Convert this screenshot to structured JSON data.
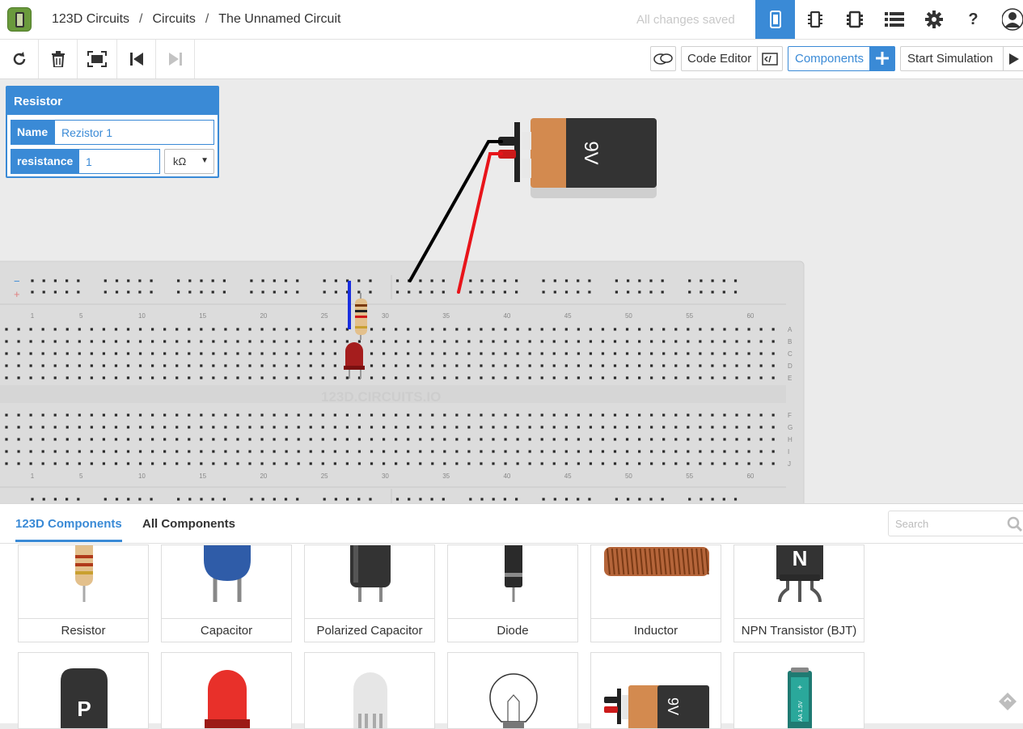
{
  "header": {
    "breadcrumb": [
      "123D Circuits",
      "Circuits",
      "The Unnamed Circuit"
    ],
    "breadcrumb_sep": "/",
    "status": "All changes saved",
    "icons": [
      "breadboard-view-icon",
      "schematic-view-icon",
      "pcb-view-icon",
      "list-icon",
      "gear-icon",
      "help-icon",
      "avatar-icon"
    ],
    "help_label": "?"
  },
  "toolbar": {
    "tools": [
      "rotate-icon",
      "trash-icon",
      "fit-view-icon",
      "step-back-icon",
      "step-forward-icon"
    ],
    "code_editor_label": "Code Editor",
    "components_label": "Components",
    "start_simulation_label": "Start Simulation"
  },
  "inspector": {
    "title": "Resistor",
    "name_label": "Name",
    "name_value": "Rezistor 1",
    "resistance_label": "resistance",
    "resistance_value": "1",
    "unit": "kΩ"
  },
  "breadboard": {
    "watermark": "123D.CIRCUITS.IO",
    "column_numbers": [
      "1",
      "5",
      "10",
      "15",
      "20",
      "25",
      "30",
      "35",
      "40",
      "45",
      "50",
      "55",
      "60"
    ],
    "row_letters_top": [
      "A",
      "B",
      "C",
      "D",
      "E"
    ],
    "row_letters_bottom": [
      "F",
      "G",
      "H",
      "I",
      "J"
    ],
    "rail_minus": "−",
    "rail_plus": "+"
  },
  "battery": {
    "label": "9V"
  },
  "library": {
    "tabs": [
      "123D Components",
      "All Components"
    ],
    "search_placeholder": "Search",
    "row1": [
      "Resistor",
      "Capacitor",
      "Polarized Capacitor",
      "Diode",
      "Inductor",
      "NPN Transistor (BJT)"
    ],
    "transistor_letters": [
      "N",
      "P"
    ],
    "battery_label": "9V",
    "cell_label": "AA 1.5V"
  },
  "colors": {
    "accent": "#3a8ad6",
    "wire_black": "#000000",
    "wire_red": "#e8141a",
    "wire_blue": "#1a2fe0",
    "led_red": "#b02020"
  }
}
